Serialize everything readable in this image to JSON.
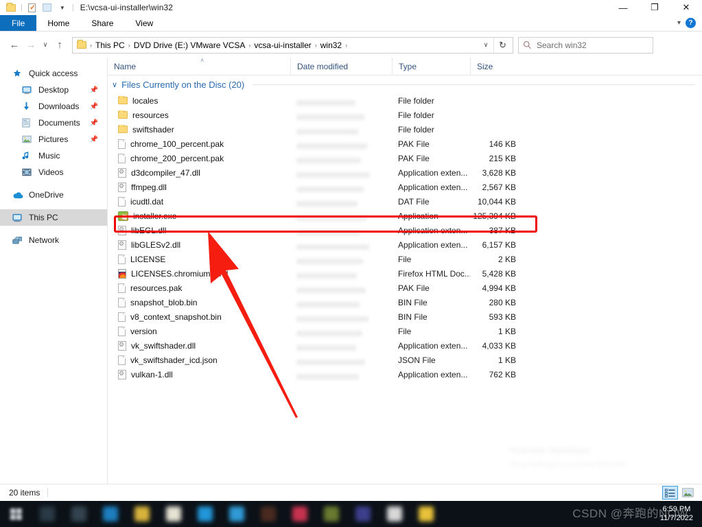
{
  "window": {
    "title_path": "E:\\vcsa-ui-installer\\win32",
    "quick_access_toolbar": [
      {
        "name": "folder-icon",
        "label": "Customize Quick Access Toolbar"
      },
      {
        "name": "properties-icon",
        "label": "Properties"
      },
      {
        "name": "new-folder-icon",
        "label": "New folder"
      },
      {
        "name": "chevron-down-icon",
        "label": "Customize"
      }
    ],
    "controls": {
      "minimize": "—",
      "maximize": "❐",
      "close": "✕"
    }
  },
  "ribbon": {
    "tabs": [
      {
        "label": "File",
        "active": true
      },
      {
        "label": "Home",
        "active": false
      },
      {
        "label": "Share",
        "active": false
      },
      {
        "label": "View",
        "active": false
      }
    ],
    "collapse_icon": "chevron-down-icon",
    "help_label": "?"
  },
  "nav": {
    "back": "←",
    "forward": "→",
    "recent": "∨",
    "up": "↑",
    "breadcrumbs": [
      "This PC",
      "DVD Drive (E:) VMware VCSA",
      "vcsa-ui-installer",
      "win32"
    ],
    "breadcrumb_separator": "›",
    "dropdown": "∨",
    "refresh": "↻"
  },
  "search": {
    "placeholder": "Search win32",
    "icon": "search-icon",
    "value": ""
  },
  "sidebar": {
    "items": [
      {
        "label": "Quick access",
        "icon": "star-icon",
        "indent": 0,
        "pinned": false,
        "selected": false
      },
      {
        "label": "Desktop",
        "icon": "desktop-icon",
        "indent": 1,
        "pinned": true,
        "selected": false
      },
      {
        "label": "Downloads",
        "icon": "download-icon",
        "indent": 1,
        "pinned": true,
        "selected": false
      },
      {
        "label": "Documents",
        "icon": "documents-icon",
        "indent": 1,
        "pinned": true,
        "selected": false
      },
      {
        "label": "Pictures",
        "icon": "pictures-icon",
        "indent": 1,
        "pinned": true,
        "selected": false
      },
      {
        "label": "Music",
        "icon": "music-icon",
        "indent": 1,
        "pinned": false,
        "selected": false
      },
      {
        "label": "Videos",
        "icon": "videos-icon",
        "indent": 1,
        "pinned": false,
        "selected": false
      },
      {
        "label": "OneDrive",
        "icon": "onedrive-icon",
        "indent": 0,
        "pinned": false,
        "selected": false
      },
      {
        "label": "This PC",
        "icon": "thispc-icon",
        "indent": 0,
        "pinned": false,
        "selected": true
      },
      {
        "label": "Network",
        "icon": "network-icon",
        "indent": 0,
        "pinned": false,
        "selected": false
      }
    ]
  },
  "file_list": {
    "columns": [
      {
        "label": "Name",
        "sorted": true,
        "sort_glyph": "˄"
      },
      {
        "label": "Date modified",
        "sorted": false
      },
      {
        "label": "Type",
        "sorted": false
      },
      {
        "label": "Size",
        "sorted": false
      }
    ],
    "group_header": {
      "chevron": "∨",
      "label": "Files Currently on the Disc (20)"
    },
    "rows": [
      {
        "name": "locales",
        "icon": "folder-icon",
        "date": "",
        "type": "File folder",
        "size": ""
      },
      {
        "name": "resources",
        "icon": "folder-icon",
        "date": "",
        "type": "File folder",
        "size": ""
      },
      {
        "name": "swiftshader",
        "icon": "folder-icon",
        "date": "",
        "type": "File folder",
        "size": ""
      },
      {
        "name": "chrome_100_percent.pak",
        "icon": "file-icon",
        "date": "",
        "type": "PAK File",
        "size": "146 KB"
      },
      {
        "name": "chrome_200_percent.pak",
        "icon": "file-icon",
        "date": "",
        "type": "PAK File",
        "size": "215 KB"
      },
      {
        "name": "d3dcompiler_47.dll",
        "icon": "dll-icon",
        "date": "",
        "type": "Application exten...",
        "size": "3,628 KB"
      },
      {
        "name": "ffmpeg.dll",
        "icon": "dll-icon",
        "date": "",
        "type": "Application exten...",
        "size": "2,567 KB"
      },
      {
        "name": "icudtl.dat",
        "icon": "file-icon",
        "date": "",
        "type": "DAT File",
        "size": "10,044 KB"
      },
      {
        "name": "installer.exe",
        "icon": "exe-icon",
        "date": "",
        "type": "Application",
        "size": "125,394 KB",
        "highlighted": true
      },
      {
        "name": "libEGL.dll",
        "icon": "dll-icon",
        "date": "",
        "type": "Application exten...",
        "size": "387 KB"
      },
      {
        "name": "libGLESv2.dll",
        "icon": "dll-icon",
        "date": "",
        "type": "Application exten...",
        "size": "6,157 KB"
      },
      {
        "name": "LICENSE",
        "icon": "file-icon",
        "date": "",
        "type": "File",
        "size": "2 KB"
      },
      {
        "name": "LICENSES.chromium.html",
        "icon": "html-icon",
        "date": "",
        "type": "Firefox HTML Doc...",
        "size": "5,428 KB"
      },
      {
        "name": "resources.pak",
        "icon": "file-icon",
        "date": "",
        "type": "PAK File",
        "size": "4,994 KB"
      },
      {
        "name": "snapshot_blob.bin",
        "icon": "file-icon",
        "date": "",
        "type": "BIN File",
        "size": "280 KB"
      },
      {
        "name": "v8_context_snapshot.bin",
        "icon": "file-icon",
        "date": "",
        "type": "BIN File",
        "size": "593 KB"
      },
      {
        "name": "version",
        "icon": "file-icon",
        "date": "",
        "type": "File",
        "size": "1 KB"
      },
      {
        "name": "vk_swiftshader.dll",
        "icon": "dll-icon",
        "date": "",
        "type": "Application exten...",
        "size": "4,033 KB"
      },
      {
        "name": "vk_swiftshader_icd.json",
        "icon": "file-icon",
        "date": "",
        "type": "JSON File",
        "size": "1 KB"
      },
      {
        "name": "vulkan-1.dll",
        "icon": "dll-icon",
        "date": "",
        "type": "Application exten...",
        "size": "762 KB"
      }
    ]
  },
  "annotation": {
    "highlight_color": "#f00606",
    "arrow_color": "#f51c10",
    "target_row": "installer.exe"
  },
  "status_bar": {
    "item_count": "20 items",
    "view_buttons": [
      {
        "name": "details-view-button",
        "active": true
      },
      {
        "name": "large-icons-view-button",
        "active": false
      }
    ]
  },
  "activate_watermark": {
    "line1": "Activate Windows",
    "line2": "Go to Settings to activate Windows."
  },
  "taskbar": {
    "clock_time": "6:59 PM",
    "clock_date": "11/7/2022",
    "watermark": "CSDN @奔跑的NOW"
  }
}
